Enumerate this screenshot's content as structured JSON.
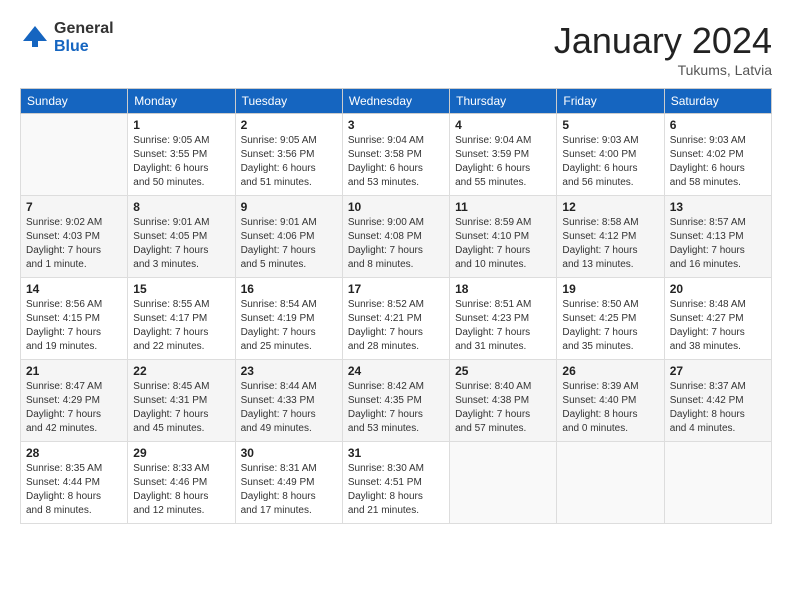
{
  "logo": {
    "general": "General",
    "blue": "Blue"
  },
  "title": "January 2024",
  "location": "Tukums, Latvia",
  "days_of_week": [
    "Sunday",
    "Monday",
    "Tuesday",
    "Wednesday",
    "Thursday",
    "Friday",
    "Saturday"
  ],
  "weeks": [
    [
      {
        "day": "",
        "info": ""
      },
      {
        "day": "1",
        "info": "Sunrise: 9:05 AM\nSunset: 3:55 PM\nDaylight: 6 hours\nand 50 minutes."
      },
      {
        "day": "2",
        "info": "Sunrise: 9:05 AM\nSunset: 3:56 PM\nDaylight: 6 hours\nand 51 minutes."
      },
      {
        "day": "3",
        "info": "Sunrise: 9:04 AM\nSunset: 3:58 PM\nDaylight: 6 hours\nand 53 minutes."
      },
      {
        "day": "4",
        "info": "Sunrise: 9:04 AM\nSunset: 3:59 PM\nDaylight: 6 hours\nand 55 minutes."
      },
      {
        "day": "5",
        "info": "Sunrise: 9:03 AM\nSunset: 4:00 PM\nDaylight: 6 hours\nand 56 minutes."
      },
      {
        "day": "6",
        "info": "Sunrise: 9:03 AM\nSunset: 4:02 PM\nDaylight: 6 hours\nand 58 minutes."
      }
    ],
    [
      {
        "day": "7",
        "info": "Sunrise: 9:02 AM\nSunset: 4:03 PM\nDaylight: 7 hours\nand 1 minute."
      },
      {
        "day": "8",
        "info": "Sunrise: 9:01 AM\nSunset: 4:05 PM\nDaylight: 7 hours\nand 3 minutes."
      },
      {
        "day": "9",
        "info": "Sunrise: 9:01 AM\nSunset: 4:06 PM\nDaylight: 7 hours\nand 5 minutes."
      },
      {
        "day": "10",
        "info": "Sunrise: 9:00 AM\nSunset: 4:08 PM\nDaylight: 7 hours\nand 8 minutes."
      },
      {
        "day": "11",
        "info": "Sunrise: 8:59 AM\nSunset: 4:10 PM\nDaylight: 7 hours\nand 10 minutes."
      },
      {
        "day": "12",
        "info": "Sunrise: 8:58 AM\nSunset: 4:12 PM\nDaylight: 7 hours\nand 13 minutes."
      },
      {
        "day": "13",
        "info": "Sunrise: 8:57 AM\nSunset: 4:13 PM\nDaylight: 7 hours\nand 16 minutes."
      }
    ],
    [
      {
        "day": "14",
        "info": "Sunrise: 8:56 AM\nSunset: 4:15 PM\nDaylight: 7 hours\nand 19 minutes."
      },
      {
        "day": "15",
        "info": "Sunrise: 8:55 AM\nSunset: 4:17 PM\nDaylight: 7 hours\nand 22 minutes."
      },
      {
        "day": "16",
        "info": "Sunrise: 8:54 AM\nSunset: 4:19 PM\nDaylight: 7 hours\nand 25 minutes."
      },
      {
        "day": "17",
        "info": "Sunrise: 8:52 AM\nSunset: 4:21 PM\nDaylight: 7 hours\nand 28 minutes."
      },
      {
        "day": "18",
        "info": "Sunrise: 8:51 AM\nSunset: 4:23 PM\nDaylight: 7 hours\nand 31 minutes."
      },
      {
        "day": "19",
        "info": "Sunrise: 8:50 AM\nSunset: 4:25 PM\nDaylight: 7 hours\nand 35 minutes."
      },
      {
        "day": "20",
        "info": "Sunrise: 8:48 AM\nSunset: 4:27 PM\nDaylight: 7 hours\nand 38 minutes."
      }
    ],
    [
      {
        "day": "21",
        "info": "Sunrise: 8:47 AM\nSunset: 4:29 PM\nDaylight: 7 hours\nand 42 minutes."
      },
      {
        "day": "22",
        "info": "Sunrise: 8:45 AM\nSunset: 4:31 PM\nDaylight: 7 hours\nand 45 minutes."
      },
      {
        "day": "23",
        "info": "Sunrise: 8:44 AM\nSunset: 4:33 PM\nDaylight: 7 hours\nand 49 minutes."
      },
      {
        "day": "24",
        "info": "Sunrise: 8:42 AM\nSunset: 4:35 PM\nDaylight: 7 hours\nand 53 minutes."
      },
      {
        "day": "25",
        "info": "Sunrise: 8:40 AM\nSunset: 4:38 PM\nDaylight: 7 hours\nand 57 minutes."
      },
      {
        "day": "26",
        "info": "Sunrise: 8:39 AM\nSunset: 4:40 PM\nDaylight: 8 hours\nand 0 minutes."
      },
      {
        "day": "27",
        "info": "Sunrise: 8:37 AM\nSunset: 4:42 PM\nDaylight: 8 hours\nand 4 minutes."
      }
    ],
    [
      {
        "day": "28",
        "info": "Sunrise: 8:35 AM\nSunset: 4:44 PM\nDaylight: 8 hours\nand 8 minutes."
      },
      {
        "day": "29",
        "info": "Sunrise: 8:33 AM\nSunset: 4:46 PM\nDaylight: 8 hours\nand 12 minutes."
      },
      {
        "day": "30",
        "info": "Sunrise: 8:31 AM\nSunset: 4:49 PM\nDaylight: 8 hours\nand 17 minutes."
      },
      {
        "day": "31",
        "info": "Sunrise: 8:30 AM\nSunset: 4:51 PM\nDaylight: 8 hours\nand 21 minutes."
      },
      {
        "day": "",
        "info": ""
      },
      {
        "day": "",
        "info": ""
      },
      {
        "day": "",
        "info": ""
      }
    ]
  ]
}
